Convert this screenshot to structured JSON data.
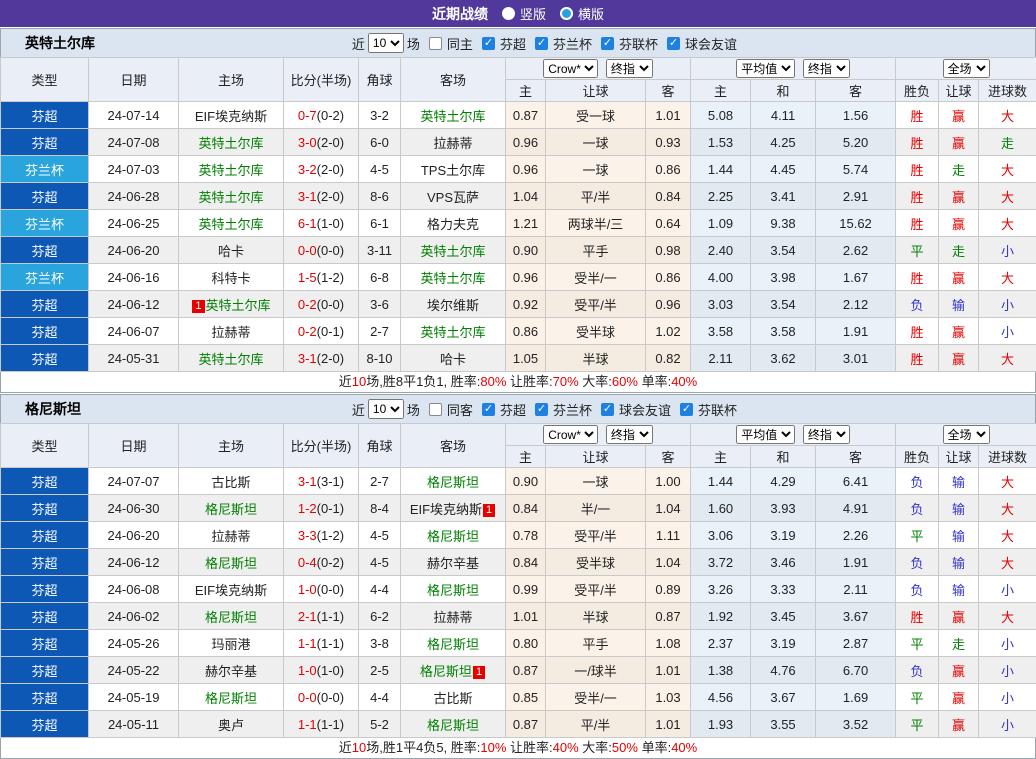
{
  "colors": {
    "titlebar": "#50399b",
    "league_badge": "#0d57b5",
    "cup_badge": "#2aa4dc",
    "win": "#e60000",
    "draw": "#008000",
    "lose": "#3333cc",
    "team_green": "#008000",
    "score_red": "#e60000",
    "card_red": "#e60000",
    "checkbox_blue": "#1e80e0"
  },
  "titlebar": {
    "title": "近期战绩",
    "radios": [
      {
        "label": "竖版",
        "checked": false
      },
      {
        "label": "横版",
        "checked": true
      }
    ]
  },
  "columns": {
    "type": "类型",
    "date": "日期",
    "home": "主场",
    "score": "比分(半场)",
    "corner": "角球",
    "away": "客场",
    "asia": {
      "provider": "Crow*",
      "final": "终指",
      "home": "主",
      "line": "让球",
      "away": "客"
    },
    "europe": {
      "provider": "平均值",
      "final": "终指",
      "home": "主",
      "draw": "和",
      "away": "客"
    },
    "result": {
      "scope": "全场",
      "wdl": "胜负",
      "handicap": "让球",
      "goals": "进球数"
    }
  },
  "tables": [
    {
      "team": "英特土尔库",
      "filter": {
        "near_label": "近",
        "count": "10",
        "games_label": "场",
        "same_label": "同主",
        "same_checked": false,
        "leagues": [
          {
            "label": "芬超",
            "checked": true
          },
          {
            "label": "芬兰杯",
            "checked": true
          },
          {
            "label": "芬联杯",
            "checked": true
          },
          {
            "label": "球会友谊",
            "checked": true
          }
        ]
      },
      "rows": [
        {
          "league": "芬超",
          "cup": false,
          "date": "24-07-14",
          "home": {
            "name": "EIF埃克纳斯"
          },
          "score": "0-7",
          "half": "(0-2)",
          "corners": "3-2",
          "away": {
            "name": "英特土尔库",
            "green": true
          },
          "asia": [
            "0.87",
            "受一球",
            "1.01"
          ],
          "europe": [
            "5.08",
            "4.11",
            "1.56"
          ],
          "results": [
            [
              "胜",
              "w"
            ],
            [
              "赢",
              "w"
            ],
            [
              "大",
              "w"
            ]
          ]
        },
        {
          "league": "芬超",
          "cup": false,
          "date": "24-07-08",
          "home": {
            "name": "英特土尔库",
            "green": true
          },
          "score": "3-0",
          "half": "(2-0)",
          "corners": "6-0",
          "away": {
            "name": "拉赫蒂"
          },
          "asia": [
            "0.96",
            "一球",
            "0.93"
          ],
          "europe": [
            "1.53",
            "4.25",
            "5.20"
          ],
          "results": [
            [
              "胜",
              "w"
            ],
            [
              "赢",
              "w"
            ],
            [
              "走",
              "d"
            ]
          ]
        },
        {
          "league": "芬兰杯",
          "cup": true,
          "date": "24-07-03",
          "home": {
            "name": "英特土尔库",
            "green": true
          },
          "score": "3-2",
          "half": "(2-0)",
          "corners": "4-5",
          "away": {
            "name": "TPS土尔库"
          },
          "asia": [
            "0.96",
            "一球",
            "0.86"
          ],
          "europe": [
            "1.44",
            "4.45",
            "5.74"
          ],
          "results": [
            [
              "胜",
              "w"
            ],
            [
              "走",
              "d"
            ],
            [
              "大",
              "w"
            ]
          ]
        },
        {
          "league": "芬超",
          "cup": false,
          "date": "24-06-28",
          "home": {
            "name": "英特土尔库",
            "green": true
          },
          "score": "3-1",
          "half": "(2-0)",
          "corners": "8-6",
          "away": {
            "name": "VPS瓦萨"
          },
          "asia": [
            "1.04",
            "平/半",
            "0.84"
          ],
          "europe": [
            "2.25",
            "3.41",
            "2.91"
          ],
          "results": [
            [
              "胜",
              "w"
            ],
            [
              "赢",
              "w"
            ],
            [
              "大",
              "w"
            ]
          ]
        },
        {
          "league": "芬兰杯",
          "cup": true,
          "date": "24-06-25",
          "home": {
            "name": "英特土尔库",
            "green": true
          },
          "score": "6-1",
          "half": "(1-0)",
          "corners": "6-1",
          "away": {
            "name": "格力夫克"
          },
          "asia": [
            "1.21",
            "两球半/三",
            "0.64"
          ],
          "europe": [
            "1.09",
            "9.38",
            "15.62"
          ],
          "results": [
            [
              "胜",
              "w"
            ],
            [
              "赢",
              "w"
            ],
            [
              "大",
              "w"
            ]
          ]
        },
        {
          "league": "芬超",
          "cup": false,
          "date": "24-06-20",
          "home": {
            "name": "哈卡"
          },
          "score": "0-0",
          "half": "(0-0)",
          "corners": "3-11",
          "away": {
            "name": "英特土尔库",
            "green": true
          },
          "asia": [
            "0.90",
            "平手",
            "0.98"
          ],
          "europe": [
            "2.40",
            "3.54",
            "2.62"
          ],
          "results": [
            [
              "平",
              "d"
            ],
            [
              "走",
              "d"
            ],
            [
              "小",
              "l"
            ]
          ]
        },
        {
          "league": "芬兰杯",
          "cup": true,
          "date": "24-06-16",
          "home": {
            "name": "科特卡"
          },
          "score": "1-5",
          "half": "(1-2)",
          "corners": "6-8",
          "away": {
            "name": "英特土尔库",
            "green": true
          },
          "asia": [
            "0.96",
            "受半/一",
            "0.86"
          ],
          "europe": [
            "4.00",
            "3.98",
            "1.67"
          ],
          "results": [
            [
              "胜",
              "w"
            ],
            [
              "赢",
              "w"
            ],
            [
              "大",
              "w"
            ]
          ]
        },
        {
          "league": "芬超",
          "cup": false,
          "date": "24-06-12",
          "home": {
            "name": "英特土尔库",
            "green": true,
            "card": "1",
            "card_pos": "before"
          },
          "score": "0-2",
          "half": "(0-0)",
          "corners": "3-6",
          "away": {
            "name": "埃尔维斯"
          },
          "asia": [
            "0.92",
            "受平/半",
            "0.96"
          ],
          "europe": [
            "3.03",
            "3.54",
            "2.12"
          ],
          "results": [
            [
              "负",
              "l"
            ],
            [
              "输",
              "l"
            ],
            [
              "小",
              "l"
            ]
          ]
        },
        {
          "league": "芬超",
          "cup": false,
          "date": "24-06-07",
          "home": {
            "name": "拉赫蒂"
          },
          "score": "0-2",
          "half": "(0-1)",
          "corners": "2-7",
          "away": {
            "name": "英特土尔库",
            "green": true
          },
          "asia": [
            "0.86",
            "受半球",
            "1.02"
          ],
          "europe": [
            "3.58",
            "3.58",
            "1.91"
          ],
          "results": [
            [
              "胜",
              "w"
            ],
            [
              "赢",
              "w"
            ],
            [
              "小",
              "l"
            ]
          ]
        },
        {
          "league": "芬超",
          "cup": false,
          "date": "24-05-31",
          "home": {
            "name": "英特土尔库",
            "green": true
          },
          "score": "3-1",
          "half": "(2-0)",
          "corners": "8-10",
          "away": {
            "name": "哈卡"
          },
          "asia": [
            "1.05",
            "半球",
            "0.82"
          ],
          "europe": [
            "2.11",
            "3.62",
            "3.01"
          ],
          "results": [
            [
              "胜",
              "w"
            ],
            [
              "赢",
              "w"
            ],
            [
              "大",
              "w"
            ]
          ]
        }
      ],
      "summary": [
        {
          "t": "近"
        },
        {
          "t": "10",
          "red": true
        },
        {
          "t": "场,胜8平1负1, 胜率:"
        },
        {
          "t": "80%",
          "red": true
        },
        {
          "t": " 让胜率:"
        },
        {
          "t": "70%",
          "red": true
        },
        {
          "t": " 大率:"
        },
        {
          "t": "60%",
          "red": true
        },
        {
          "t": " 单率:"
        },
        {
          "t": "40%",
          "red": true
        }
      ]
    },
    {
      "team": "格尼斯坦",
      "filter": {
        "near_label": "近",
        "count": "10",
        "games_label": "场",
        "same_label": "同客",
        "same_checked": false,
        "leagues": [
          {
            "label": "芬超",
            "checked": true
          },
          {
            "label": "芬兰杯",
            "checked": true
          },
          {
            "label": "球会友谊",
            "checked": true
          },
          {
            "label": "芬联杯",
            "checked": true
          }
        ]
      },
      "rows": [
        {
          "league": "芬超",
          "cup": false,
          "date": "24-07-07",
          "home": {
            "name": "古比斯"
          },
          "score": "3-1",
          "half": "(3-1)",
          "corners": "2-7",
          "away": {
            "name": "格尼斯坦",
            "green": true
          },
          "asia": [
            "0.90",
            "一球",
            "1.00"
          ],
          "europe": [
            "1.44",
            "4.29",
            "6.41"
          ],
          "results": [
            [
              "负",
              "l"
            ],
            [
              "输",
              "l"
            ],
            [
              "大",
              "w"
            ]
          ]
        },
        {
          "league": "芬超",
          "cup": false,
          "date": "24-06-30",
          "home": {
            "name": "格尼斯坦",
            "green": true
          },
          "score": "1-2",
          "half": "(0-1)",
          "corners": "8-4",
          "away": {
            "name": "EIF埃克纳斯",
            "card": "1",
            "card_pos": "after"
          },
          "asia": [
            "0.84",
            "半/一",
            "1.04"
          ],
          "europe": [
            "1.60",
            "3.93",
            "4.91"
          ],
          "results": [
            [
              "负",
              "l"
            ],
            [
              "输",
              "l"
            ],
            [
              "大",
              "w"
            ]
          ]
        },
        {
          "league": "芬超",
          "cup": false,
          "date": "24-06-20",
          "home": {
            "name": "拉赫蒂"
          },
          "score": "3-3",
          "half": "(1-2)",
          "corners": "4-5",
          "away": {
            "name": "格尼斯坦",
            "green": true
          },
          "asia": [
            "0.78",
            "受平/半",
            "1.11"
          ],
          "europe": [
            "3.06",
            "3.19",
            "2.26"
          ],
          "results": [
            [
              "平",
              "d"
            ],
            [
              "输",
              "l"
            ],
            [
              "大",
              "w"
            ]
          ]
        },
        {
          "league": "芬超",
          "cup": false,
          "date": "24-06-12",
          "home": {
            "name": "格尼斯坦",
            "green": true
          },
          "score": "0-4",
          "half": "(0-2)",
          "corners": "4-5",
          "away": {
            "name": "赫尔辛基"
          },
          "asia": [
            "0.84",
            "受半球",
            "1.04"
          ],
          "europe": [
            "3.72",
            "3.46",
            "1.91"
          ],
          "results": [
            [
              "负",
              "l"
            ],
            [
              "输",
              "l"
            ],
            [
              "大",
              "w"
            ]
          ]
        },
        {
          "league": "芬超",
          "cup": false,
          "date": "24-06-08",
          "home": {
            "name": "EIF埃克纳斯"
          },
          "score": "1-0",
          "half": "(0-0)",
          "corners": "4-4",
          "away": {
            "name": "格尼斯坦",
            "green": true
          },
          "asia": [
            "0.99",
            "受平/半",
            "0.89"
          ],
          "europe": [
            "3.26",
            "3.33",
            "2.11"
          ],
          "results": [
            [
              "负",
              "l"
            ],
            [
              "输",
              "l"
            ],
            [
              "小",
              "l"
            ]
          ]
        },
        {
          "league": "芬超",
          "cup": false,
          "date": "24-06-02",
          "home": {
            "name": "格尼斯坦",
            "green": true
          },
          "score": "2-1",
          "half": "(1-1)",
          "corners": "6-2",
          "away": {
            "name": "拉赫蒂"
          },
          "asia": [
            "1.01",
            "半球",
            "0.87"
          ],
          "europe": [
            "1.92",
            "3.45",
            "3.67"
          ],
          "results": [
            [
              "胜",
              "w"
            ],
            [
              "赢",
              "w"
            ],
            [
              "大",
              "w"
            ]
          ]
        },
        {
          "league": "芬超",
          "cup": false,
          "date": "24-05-26",
          "home": {
            "name": "玛丽港"
          },
          "score": "1-1",
          "half": "(1-1)",
          "corners": "3-8",
          "away": {
            "name": "格尼斯坦",
            "green": true
          },
          "asia": [
            "0.80",
            "平手",
            "1.08"
          ],
          "europe": [
            "2.37",
            "3.19",
            "2.87"
          ],
          "results": [
            [
              "平",
              "d"
            ],
            [
              "走",
              "d"
            ],
            [
              "小",
              "l"
            ]
          ]
        },
        {
          "league": "芬超",
          "cup": false,
          "date": "24-05-22",
          "home": {
            "name": "赫尔辛基"
          },
          "score": "1-0",
          "half": "(1-0)",
          "corners": "2-5",
          "away": {
            "name": "格尼斯坦",
            "green": true,
            "card": "1",
            "card_pos": "after"
          },
          "asia": [
            "0.87",
            "一/球半",
            "1.01"
          ],
          "europe": [
            "1.38",
            "4.76",
            "6.70"
          ],
          "results": [
            [
              "负",
              "l"
            ],
            [
              "赢",
              "w"
            ],
            [
              "小",
              "l"
            ]
          ]
        },
        {
          "league": "芬超",
          "cup": false,
          "date": "24-05-19",
          "home": {
            "name": "格尼斯坦",
            "green": true
          },
          "score": "0-0",
          "half": "(0-0)",
          "corners": "4-4",
          "away": {
            "name": "古比斯"
          },
          "asia": [
            "0.85",
            "受半/一",
            "1.03"
          ],
          "europe": [
            "4.56",
            "3.67",
            "1.69"
          ],
          "results": [
            [
              "平",
              "d"
            ],
            [
              "赢",
              "w"
            ],
            [
              "小",
              "l"
            ]
          ]
        },
        {
          "league": "芬超",
          "cup": false,
          "date": "24-05-11",
          "home": {
            "name": "奥卢"
          },
          "score": "1-1",
          "half": "(1-1)",
          "corners": "5-2",
          "away": {
            "name": "格尼斯坦",
            "green": true
          },
          "asia": [
            "0.87",
            "平/半",
            "1.01"
          ],
          "europe": [
            "1.93",
            "3.55",
            "3.52"
          ],
          "results": [
            [
              "平",
              "d"
            ],
            [
              "赢",
              "w"
            ],
            [
              "小",
              "l"
            ]
          ]
        }
      ],
      "summary": [
        {
          "t": "近"
        },
        {
          "t": "10",
          "red": true
        },
        {
          "t": "场,胜1平4负5, 胜率:"
        },
        {
          "t": "10%",
          "red": true
        },
        {
          "t": " 让胜率:"
        },
        {
          "t": "40%",
          "red": true
        },
        {
          "t": " 大率:"
        },
        {
          "t": "50%",
          "red": true
        },
        {
          "t": " 单率:"
        },
        {
          "t": "40%",
          "red": true
        }
      ]
    }
  ]
}
